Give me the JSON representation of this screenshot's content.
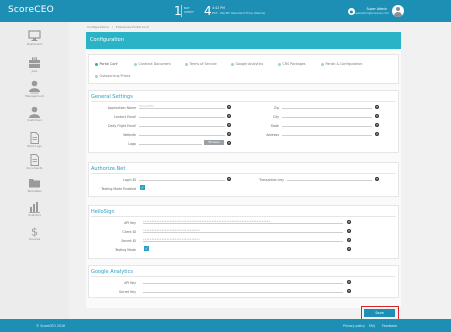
{
  "topbar": {
    "brand": "ScoreCEO",
    "version_num": "1",
    "version_label_1": "BAT",
    "version_label_2": "SHEET",
    "tz_big": "4",
    "tz_top": "4:42 PM",
    "tz_bottom": "PST - Pacific Standard Time (Sierra)",
    "bell_icon": "bell-icon",
    "user_name": "Super Admin",
    "user_email": "superadmin@scoreceo.com",
    "avatar_icon": "user-avatar-icon"
  },
  "sidebar": {
    "items": [
      {
        "label": "Dashboard",
        "icon": "monitor-icon"
      },
      {
        "label": "Jobs",
        "icon": "briefcase-icon"
      },
      {
        "label": "Client Management",
        "icon": "person-icon"
      },
      {
        "label": "Customers",
        "icon": "person-icon"
      },
      {
        "label": "Work Logs",
        "icon": "document-icon"
      },
      {
        "label": "Documents",
        "icon": "document-icon"
      },
      {
        "label": "Templates",
        "icon": "folder-icon"
      },
      {
        "label": "Analytics",
        "icon": "bar-chart-icon"
      },
      {
        "label": "Invoices",
        "icon": "dollar-icon"
      }
    ]
  },
  "breadcrumb": {
    "items": [
      "Configurations",
      "/",
      "Enterprise Portal Conf"
    ]
  },
  "page": {
    "title": "Configuration"
  },
  "tabs": [
    {
      "label": "Portal Conf",
      "active": true
    },
    {
      "label": "Contract Document",
      "active": false
    },
    {
      "label": "Terms of Service",
      "active": false
    },
    {
      "label": "Google Analytics",
      "active": false
    },
    {
      "label": "CRS Packages",
      "active": false
    },
    {
      "label": "Parish & Configuration",
      "active": false
    },
    {
      "label": "Outsourcing Prices",
      "active": false
    }
  ],
  "general": {
    "title": "General Settings",
    "app_name_label": "Application Name",
    "app_name_value": "ScoreCEO",
    "contact_email_label": "Contact Email",
    "daily_digest_label": "Daily Flight Email",
    "website_label": "Website",
    "logo_label": "Logo",
    "browse_label": "Browse",
    "zip_label": "Zip",
    "city_label": "City",
    "state_label": "State",
    "address_label": "Address"
  },
  "authorize": {
    "title": "Authorize.Net",
    "login_id_label": "Login ID",
    "transaction_key_label": "Transaction key",
    "testing_mode_label": "Testing Mode Enabled",
    "testing_mode_checked": true
  },
  "hellosign": {
    "title": "HelloSign",
    "api_key_label": "API Key",
    "api_key_value": "••••••••••••••••••••••••••••••••••••••••••••••••••••••••••••••••••••••••••••",
    "client_id_label": "Client ID",
    "client_id_value": "••••••••••••••••••••••••••••••••••",
    "secret_id_label": "Secret ID",
    "secret_id_value": "••••••••••••••••••••••••••••••••••",
    "testing_mode_label": "Testing Mode",
    "testing_mode_checked": true
  },
  "google": {
    "title": "Google Analytics",
    "api_key_label": "API Key",
    "secret_key_label": "Secret Key"
  },
  "actions": {
    "save_label": "Save"
  },
  "footer": {
    "copyright": "© ScoreCEO 2016",
    "links": [
      "Privacy policy",
      "FAQ",
      "Feedback"
    ]
  },
  "colors": {
    "brand_blue": "#1d8fb5",
    "header_teal": "#2ab3c6",
    "highlight_red": "#d9252a",
    "tab_active_green": "#3bb089"
  }
}
